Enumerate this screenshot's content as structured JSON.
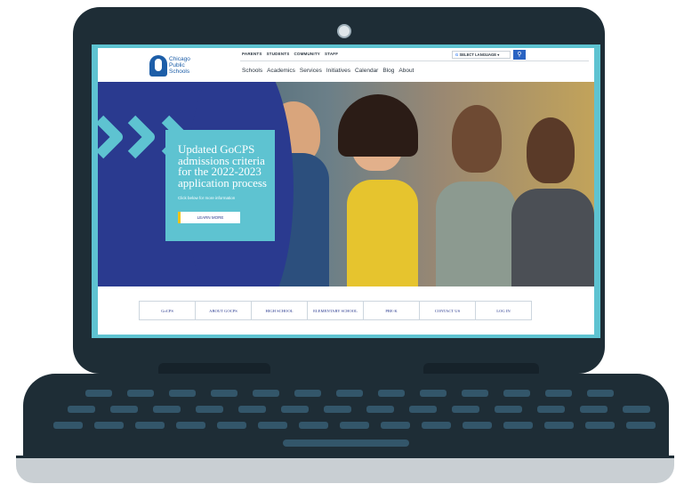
{
  "site": {
    "logo_lines": [
      "Chicago",
      "Public",
      "Schools"
    ],
    "utility_nav": [
      "PARENTS",
      "STUDENTS",
      "COMMUNITY",
      "STAFF"
    ],
    "main_nav": [
      "Schools",
      "Academics",
      "Services",
      "Initiatives",
      "Calendar",
      "Blog",
      "About"
    ],
    "language_select": "SELECT LANGUAGE",
    "search_icon": "search-icon"
  },
  "hero": {
    "title": "Updated GoCPS admissions criteria for the 2022-2023 application process",
    "subtitle": "Click below for more information",
    "button_label": "LEARN MORE"
  },
  "linkbar": {
    "brand": "GoCPS",
    "links": [
      "ABOUT GOCPS",
      "HIGH SCHOOL",
      "ELEMENTARY SCHOOL",
      "PRE-K",
      "CONTACT US",
      "LOG IN"
    ]
  },
  "colors": {
    "navy": "#2a3a8f",
    "teal": "#5ec3d1",
    "laptop": "#1e2d36"
  }
}
